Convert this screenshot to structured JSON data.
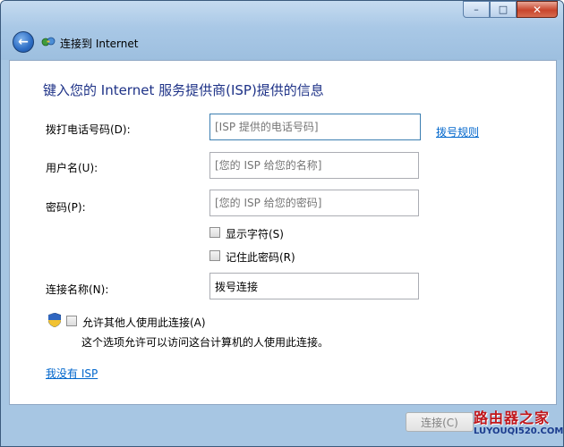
{
  "window": {
    "title": "连接到 Internet",
    "caption_min": "–",
    "caption_max": "□",
    "caption_close": "✕",
    "back_glyph": "←"
  },
  "form": {
    "heading": "键入您的 Internet 服务提供商(ISP)提供的信息",
    "phone": {
      "label": "拨打电话号码(D):",
      "placeholder": "[ISP 提供的电话号码]"
    },
    "dial_rules_link": "拨号规则",
    "username": {
      "label": "用户名(U):",
      "placeholder": "[您的 ISP 给您的名称]"
    },
    "password": {
      "label": "密码(P):",
      "placeholder": "[您的 ISP 给您的密码]"
    },
    "show_chars": {
      "label": "显示字符(S)",
      "checked": false
    },
    "remember_pwd": {
      "label": "记住此密码(R)",
      "checked": false
    },
    "conn_name": {
      "label": "连接名称(N):",
      "value": "拨号连接"
    },
    "allow_others": {
      "label": "允许其他人使用此连接(A)",
      "checked": false
    },
    "allow_hint": "这个选项允许可以访问这台计算机的人使用此连接。",
    "no_isp_link": "我没有 ISP"
  },
  "footer": {
    "connect_label": "连接(C)",
    "connect_enabled": false
  },
  "watermark": {
    "top": "路由器之家",
    "bottom": "LUYOUQI520.COM"
  },
  "colors": {
    "heading": "#1e3287",
    "link": "#0066cc",
    "frame": "#a7c6e3",
    "close": "#c8452c"
  }
}
